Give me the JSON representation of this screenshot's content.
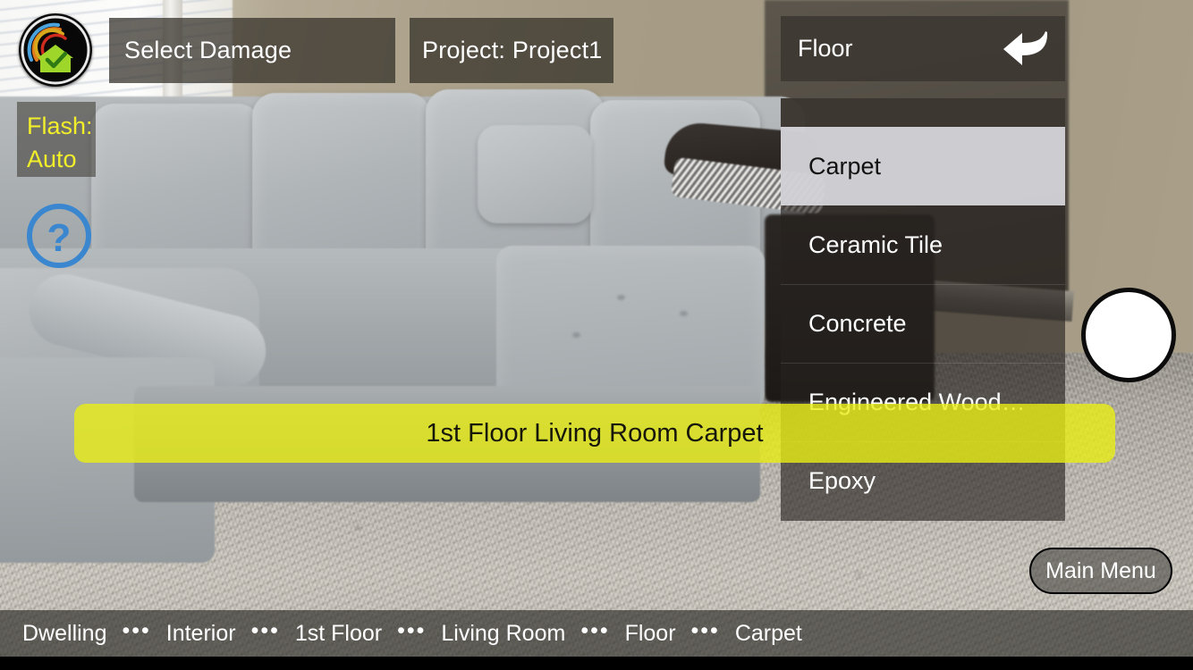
{
  "app": {
    "logo_name": "company-swirl-house-logo"
  },
  "toolbar": {
    "select_damage_label": "Select Damage",
    "project_label": "Project: Project1",
    "flash_label_line1": "Flash:",
    "flash_label_line2": "Auto",
    "help_icon": "question-mark-circle-icon",
    "shutter_icon": "camera-shutter-button",
    "main_menu_label": "Main Menu"
  },
  "floor_panel": {
    "header_title": "Floor",
    "back_icon": "back-arrow-icon",
    "items": [
      {
        "label": "Carpet",
        "selected": true
      },
      {
        "label": "Ceramic Tile",
        "selected": false
      },
      {
        "label": "Concrete",
        "selected": false
      },
      {
        "label": "Engineered Wood…",
        "selected": false
      },
      {
        "label": "Epoxy",
        "selected": false
      }
    ]
  },
  "banner": {
    "text": "1st Floor Living Room Carpet",
    "color": "#e8ed14"
  },
  "breadcrumb": {
    "separator": "•••",
    "items": [
      "Dwelling",
      "Interior",
      "1st Floor",
      "Living Room",
      "Floor",
      "Carpet"
    ]
  },
  "colors": {
    "accent_yellow": "#e8ed14",
    "flash_text": "#f2ef2a",
    "help_blue": "#3a86cf",
    "panel_dark": "#302c26",
    "selected_row": "#d8d8de"
  }
}
